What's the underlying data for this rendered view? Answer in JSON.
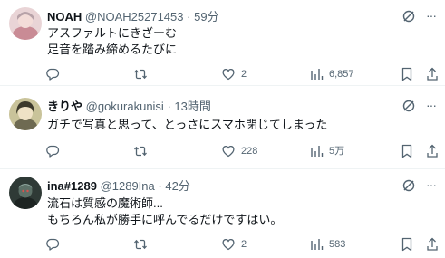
{
  "tweets": [
    {
      "name": "NOAH",
      "handle": "@NOAH25271453",
      "separator": "·",
      "time": "59分",
      "lines": [
        "アスファルトにきざーむ",
        "足音を踏み締めるたびに"
      ],
      "replies": "",
      "reposts": "",
      "likes": "2",
      "views": "6,857"
    },
    {
      "name": "きりや",
      "handle": "@gokurakunisi",
      "separator": "·",
      "time": "13時間",
      "lines": [
        "ガチで写真と思って、とっさにスマホ閉じてしまった"
      ],
      "replies": "",
      "reposts": "",
      "likes": "228",
      "views": "5万"
    },
    {
      "name": "ina#1289",
      "handle": "@1289Ina",
      "separator": "·",
      "time": "42分",
      "lines": [
        "流石は質感の魔術師...",
        "もちろん私が勝手に呼んでるだけですはい。"
      ],
      "replies": "",
      "reposts": "",
      "likes": "2",
      "views": "583"
    }
  ],
  "icons": {
    "reply": "reply-icon",
    "repost": "repost-icon",
    "like": "heart-icon",
    "views": "views-chart-icon",
    "bookmark": "bookmark-icon",
    "grok": "grok-icon",
    "more": "more-icon"
  },
  "more_glyph": "···",
  "colors": {
    "text": "#0f1419",
    "secondary": "#536471",
    "divider": "#eff3f4"
  }
}
